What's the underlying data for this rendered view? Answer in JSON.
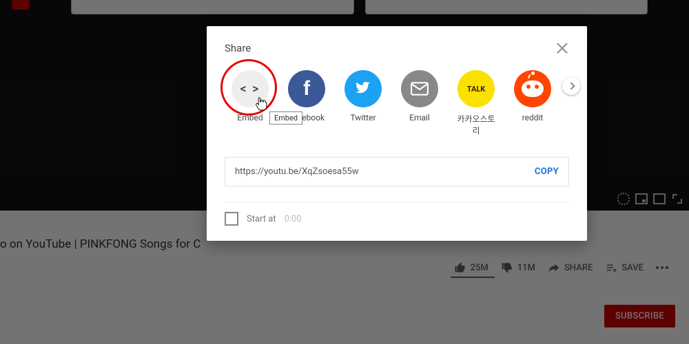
{
  "background": {
    "video_title_fragment": "o on YouTube | PINKFONG Songs for C",
    "actions": {
      "likes": "25M",
      "dislikes": "11M",
      "share": "SHARE",
      "save": "SAVE"
    },
    "subscribe": "SUBSCRIBE"
  },
  "dialog": {
    "title": "Share",
    "share_targets": {
      "embed": "Embed",
      "facebook": "Facebook",
      "twitter": "Twitter",
      "email": "Email",
      "kakao": "카카오스토리",
      "reddit": "reddit",
      "kakao_icon_text": "TALK"
    },
    "url": "https://youtu.be/XqZsoesa55w",
    "copy": "COPY",
    "start_at_label": "Start at",
    "start_at_time": "0:00",
    "tooltip_visible": "Embed"
  }
}
